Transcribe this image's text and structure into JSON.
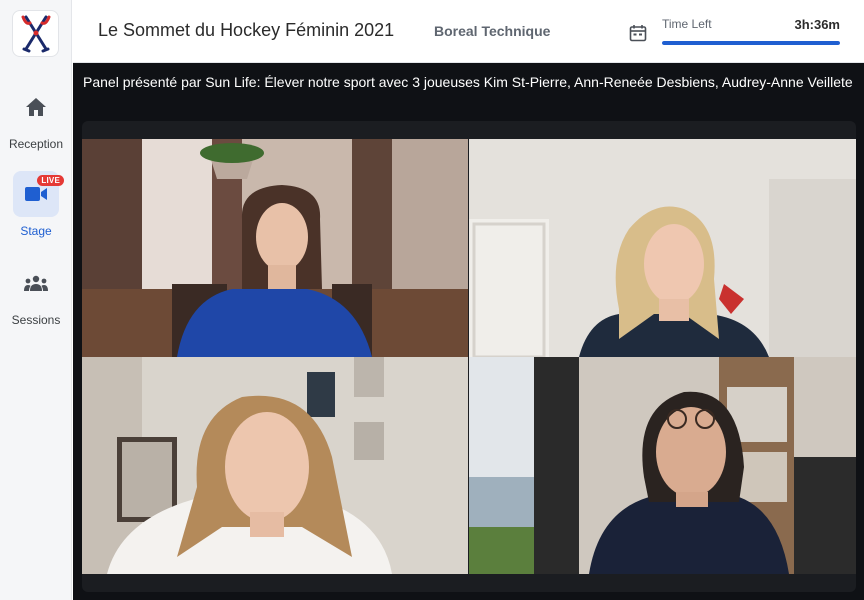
{
  "sidebar": {
    "logo_icon": "hockey-sticks-logo-icon",
    "items": [
      {
        "label": "Reception",
        "icon": "home-icon",
        "active": false
      },
      {
        "label": "Stage",
        "icon": "video-camera-icon",
        "active": true,
        "badge": "LIVE"
      },
      {
        "label": "Sessions",
        "icon": "people-group-icon",
        "active": false
      }
    ]
  },
  "header": {
    "title": "Le Sommet du Hockey Féminin 2021",
    "organizer": "Boreal Technique",
    "calendar_icon": "calendar-icon",
    "timer": {
      "label": "Time Left",
      "value": "3h:36m",
      "progress": 1.0
    }
  },
  "stage": {
    "session_title": "Panel présenté par Sun Life: Élever notre sport avec 3 joueuses Kim St-Pierre, Ann-Reneée Desbiens, Audrey-Anne Veillete",
    "participants": 4
  },
  "colors": {
    "accent": "#1f5fd1",
    "live_badge": "#e53935",
    "stage_bg": "#0f1115"
  }
}
